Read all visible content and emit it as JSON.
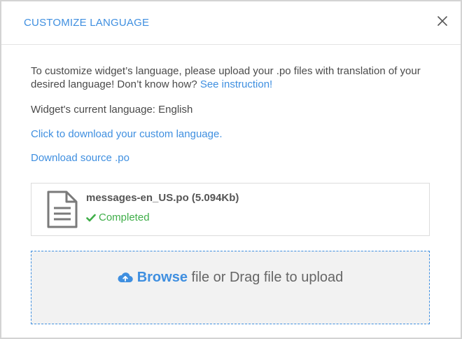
{
  "dialog": {
    "title": "CUSTOMIZE LANGUAGE",
    "close_icon": "close-icon"
  },
  "intro": {
    "text": "To customize widget’s language, please upload your .po files with translation of your desired language! Don’t know how? ",
    "link": "See instruction!"
  },
  "current_language": {
    "label": "Widget's current language: English"
  },
  "links": {
    "download_custom": "Click to download your custom language.",
    "download_source": "Download source .po"
  },
  "uploaded_file": {
    "name": "messages-en_US.po (5.094Kb)",
    "status": "Completed",
    "status_color": "#3fae49",
    "icon": "file-text-icon"
  },
  "dropzone": {
    "browse": "Browse",
    "text": " file or Drag file to upload",
    "icon": "cloud-upload-icon"
  },
  "colors": {
    "accent": "#3f8fe0",
    "text": "#4a4a4a",
    "success": "#3fae49"
  }
}
